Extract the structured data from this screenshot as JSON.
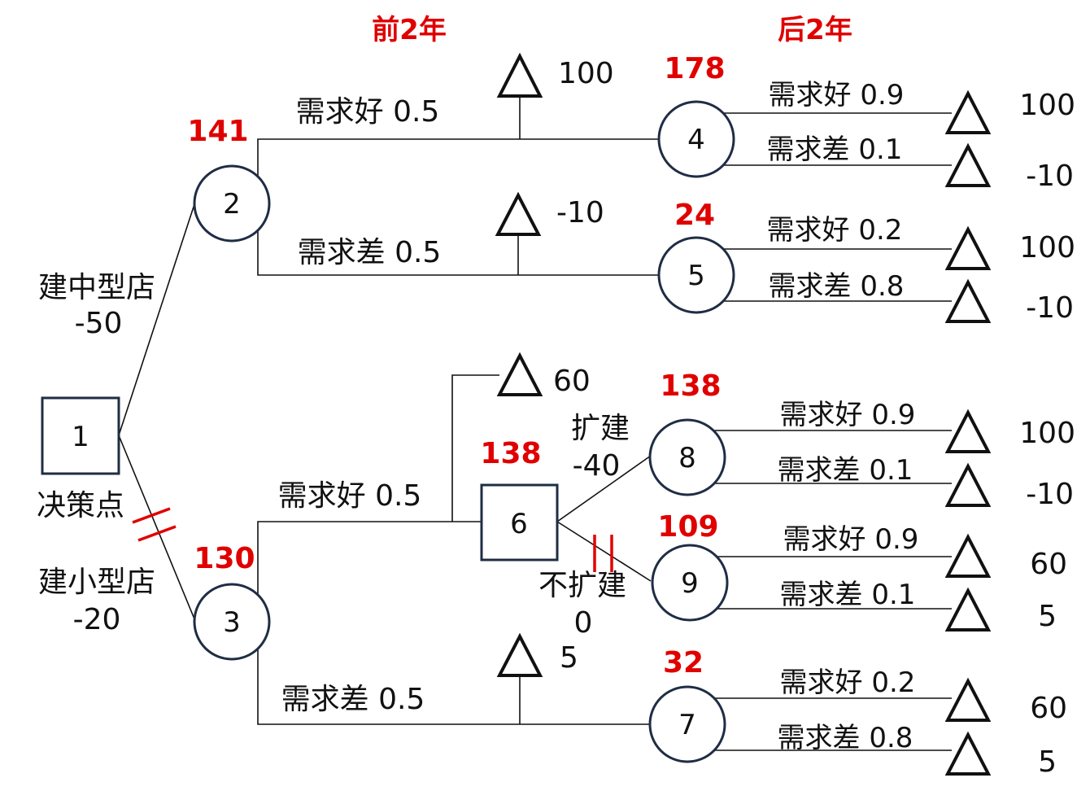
{
  "colors": {
    "accent": "#e00000",
    "node_stroke": "#1f2d44",
    "line": "#111111"
  },
  "headers": {
    "first_period": "前2年",
    "second_period": "后2年"
  },
  "decision_node": {
    "id": "1",
    "caption": "决策点"
  },
  "options": {
    "medium": {
      "name": "建中型店",
      "cost": "-50"
    },
    "small": {
      "name": "建小型店",
      "cost": "-20"
    }
  },
  "nodes": {
    "n2": {
      "id": "2",
      "ev": "141"
    },
    "n3": {
      "id": "3",
      "ev": "130"
    },
    "n4": {
      "id": "4",
      "ev": "178"
    },
    "n5": {
      "id": "5",
      "ev": "24"
    },
    "n6": {
      "id": "6",
      "ev": "138"
    },
    "n7": {
      "id": "7",
      "ev": "32"
    },
    "n8": {
      "id": "8",
      "ev": "138"
    },
    "n9": {
      "id": "9",
      "ev": "109"
    }
  },
  "first_period_branches": {
    "n2_good": "需求好 0.5",
    "n2_bad": "需求差 0.5",
    "n3_good": "需求好 0.5",
    "n3_bad": "需求差 0.5"
  },
  "first_period_payoffs": {
    "n2_good": "100",
    "n2_bad": "-10",
    "n3_good": "60",
    "n3_bad": "5"
  },
  "expansion": {
    "expand": {
      "name": "扩建",
      "cost": "-40"
    },
    "no_expand": {
      "name": "不扩建",
      "cost": "0"
    }
  },
  "second_period": {
    "n4": {
      "good": "需求好 0.9",
      "bad": "需求差 0.1",
      "good_payoff": "100",
      "bad_payoff": "-10"
    },
    "n5": {
      "good": "需求好 0.2",
      "bad": "需求差 0.8",
      "good_payoff": "100",
      "bad_payoff": "-10"
    },
    "n8": {
      "good": "需求好 0.9",
      "bad": "需求差 0.1",
      "good_payoff": "100",
      "bad_payoff": "-10"
    },
    "n9": {
      "good": "需求好 0.9",
      "bad": "需求差 0.1",
      "good_payoff": "60",
      "bad_payoff": "5"
    },
    "n7": {
      "good": "需求好 0.2",
      "bad": "需求差 0.8",
      "good_payoff": "60",
      "bad_payoff": "5"
    }
  }
}
